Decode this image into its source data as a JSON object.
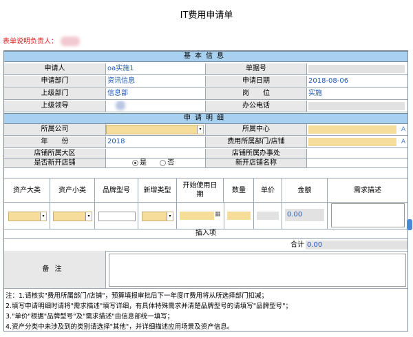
{
  "title": "IT费用申请单",
  "owner_label": "表单说明负责人：",
  "sections": {
    "basic": "基本信息",
    "detail": "申请明细"
  },
  "basic": {
    "applicant_label": "申请人",
    "applicant_value": "oa实施1",
    "doc_no_label": "单据号",
    "dept_label": "申请部门",
    "dept_value": "资讯信息",
    "date_label": "申请日期",
    "date_value": "2018-08-06",
    "superior_dept_label": "上级部门",
    "superior_dept_value": "信息部",
    "position_label": "岗　　位",
    "position_value": "实施",
    "superior_leader_label": "上级领导",
    "office_phone_label": "办公电话"
  },
  "detail": {
    "company_label": "所属公司",
    "center_label": "所属中心",
    "year_label": "年　　份",
    "year_value": "2018",
    "cost_dept_label": "费用所属部门/店铺",
    "store_region_label": "店铺所属大区",
    "store_office_label": "店铺所属办事处",
    "new_store_label": "是否新开店铺",
    "yes_label": "是",
    "no_label": "否",
    "new_store_name_label": "新开店铺名称"
  },
  "table": {
    "headers": [
      "资产大类",
      "资产小类",
      "品牌型号",
      "新增类型",
      "开始使用日期",
      "数量",
      "单价",
      "金额",
      "需求描述"
    ],
    "amount_value": "0.00",
    "insert_label": "插入项",
    "total_label": "合计",
    "total_value": "0.00"
  },
  "remark_label": "备注",
  "notes": [
    "注：1.请核实\"费用所属部门/店铺\"，预算填报审批后下一年度IT费用将从所选择部门扣减；",
    "2.填写申请明细时请将\"需求描述\"填写详细，有具体特殊需求并清楚品牌型号的请填写\"品牌型号\"；",
    "3.\"单价\"根据\"品牌型号\"及\"需求描述\"由信息部统一填写；",
    "4.资产分类中未涉及到的类别请选择\"其他\"，并详细描述应用场景及资产信息。"
  ],
  "colors": {
    "section_bg": "#a8d1f0",
    "input_yellow": "#f7dd9c",
    "value_blue": "#1f58b6",
    "owner_red": "#e02020"
  }
}
